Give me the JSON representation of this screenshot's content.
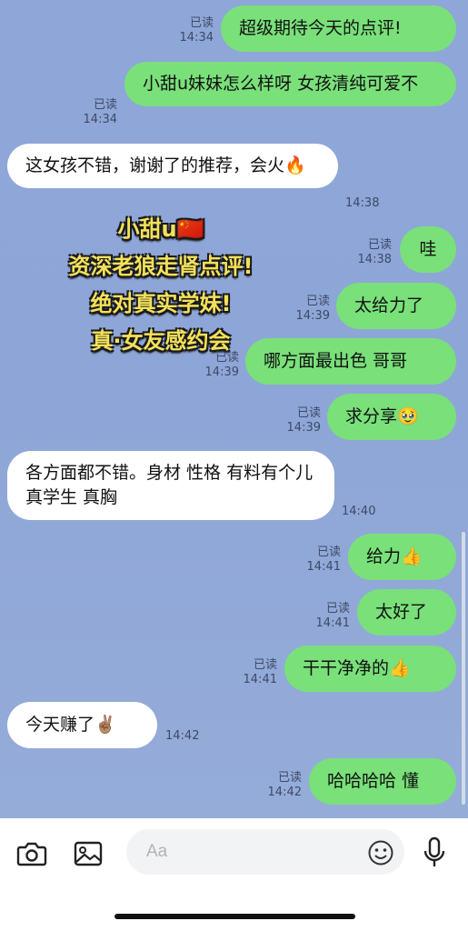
{
  "messages": [
    {
      "text": "超级期待今天的点评!",
      "read": "已读",
      "time": "14:34"
    },
    {
      "text": "小甜u妹妹怎么样呀 女孩清纯可爱不",
      "read": "已读",
      "time": "14:34"
    },
    {
      "text": "这女孩不错，谢谢了的推荐，会火🔥",
      "time": "14:38"
    },
    {
      "text": "哇",
      "read": "已读",
      "time": "14:38"
    },
    {
      "text": "太给力了",
      "read": "已读",
      "time": "14:39"
    },
    {
      "text": "哪方面最出色 哥哥",
      "read": "已读",
      "time": "14:39"
    },
    {
      "text": "求分享🥹",
      "read": "已读",
      "time": "14:39"
    },
    {
      "text": "各方面都不错。身材 性格 有料有个儿 真学生 真胸",
      "time": "14:40"
    },
    {
      "text": "给力👍",
      "read": "已读",
      "time": "14:41"
    },
    {
      "text": "太好了",
      "read": "已读",
      "time": "14:41"
    },
    {
      "text": "干干净净的👍",
      "read": "已读",
      "time": "14:41"
    },
    {
      "text": "今天赚了✌🏽",
      "time": "14:42"
    },
    {
      "text": "哈哈哈哈 懂",
      "read": "已读",
      "time": "14:42"
    }
  ],
  "overlay": {
    "lines": [
      "小甜u🇨🇳",
      "资深老狼走肾点评!",
      "绝对真实学妹!",
      "真·女友感约会"
    ]
  },
  "input": {
    "placeholder": "Aa"
  },
  "icons": {
    "camera": "camera-icon",
    "image": "image-icon",
    "emoji": "emoji-icon",
    "mic": "microphone-icon"
  },
  "colors": {
    "background": "#8fa6d8",
    "outgoing_bubble": "#79e07a",
    "incoming_bubble": "#ffffff",
    "overlay_text": "#f3e15a"
  }
}
